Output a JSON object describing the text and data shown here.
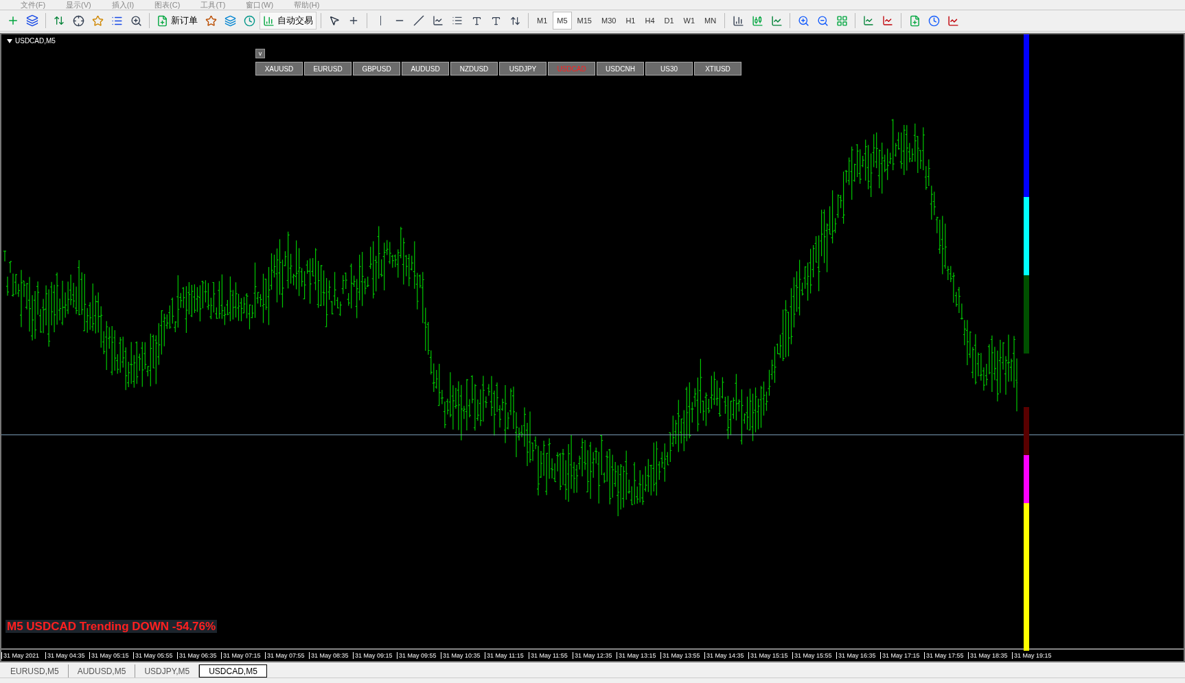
{
  "menu": [
    "文件(F)",
    "显示(V)",
    "插入(I)",
    "图表(C)",
    "工具(T)",
    "窗口(W)",
    "帮助(H)"
  ],
  "toolbar": {
    "new_order": "新订单",
    "auto_trading": "自动交易",
    "timeframes": [
      {
        "label": "M1",
        "selected": false
      },
      {
        "label": "M5",
        "selected": true
      },
      {
        "label": "M15",
        "selected": false
      },
      {
        "label": "M30",
        "selected": false
      },
      {
        "label": "H1",
        "selected": false
      },
      {
        "label": "H4",
        "selected": false
      },
      {
        "label": "D1",
        "selected": false
      },
      {
        "label": "W1",
        "selected": false
      },
      {
        "label": "MN",
        "selected": false
      }
    ]
  },
  "chart": {
    "title": "USDCAD,M5",
    "toggle": "v",
    "symbols": [
      {
        "label": "XAUUSD",
        "selected": false
      },
      {
        "label": "EURUSD",
        "selected": false
      },
      {
        "label": "GBPUSD",
        "selected": false
      },
      {
        "label": "AUDUSD",
        "selected": false
      },
      {
        "label": "NZDUSD",
        "selected": false
      },
      {
        "label": "USDJPY",
        "selected": false
      },
      {
        "label": "USDCAD",
        "selected": true
      },
      {
        "label": "USDCNH",
        "selected": false
      },
      {
        "label": "US30",
        "selected": false
      },
      {
        "label": "XTIUSD",
        "selected": false
      }
    ],
    "signal": "M5 USDCAD Trending DOWN -54.76%",
    "time_labels": [
      "31 May 2021",
      "31 May 04:35",
      "31 May 05:15",
      "31 May 05:55",
      "31 May 06:35",
      "31 May 07:15",
      "31 May 07:55",
      "31 May 08:35",
      "31 May 09:15",
      "31 May 09:55",
      "31 May 10:35",
      "31 May 11:15",
      "31 May 11:55",
      "31 May 12:35",
      "31 May 13:15",
      "31 May 13:55",
      "31 May 14:35",
      "31 May 15:15",
      "31 May 15:55",
      "31 May 16:35",
      "31 May 17:15",
      "31 May 17:55",
      "31 May 18:35",
      "31 May 19:15"
    ]
  },
  "tabs": [
    {
      "label": "EURUSD,M5",
      "selected": false
    },
    {
      "label": "AUDUSD,M5",
      "selected": false
    },
    {
      "label": "USDJPY,M5",
      "selected": false
    },
    {
      "label": "USDCAD,M5",
      "selected": true
    }
  ]
}
